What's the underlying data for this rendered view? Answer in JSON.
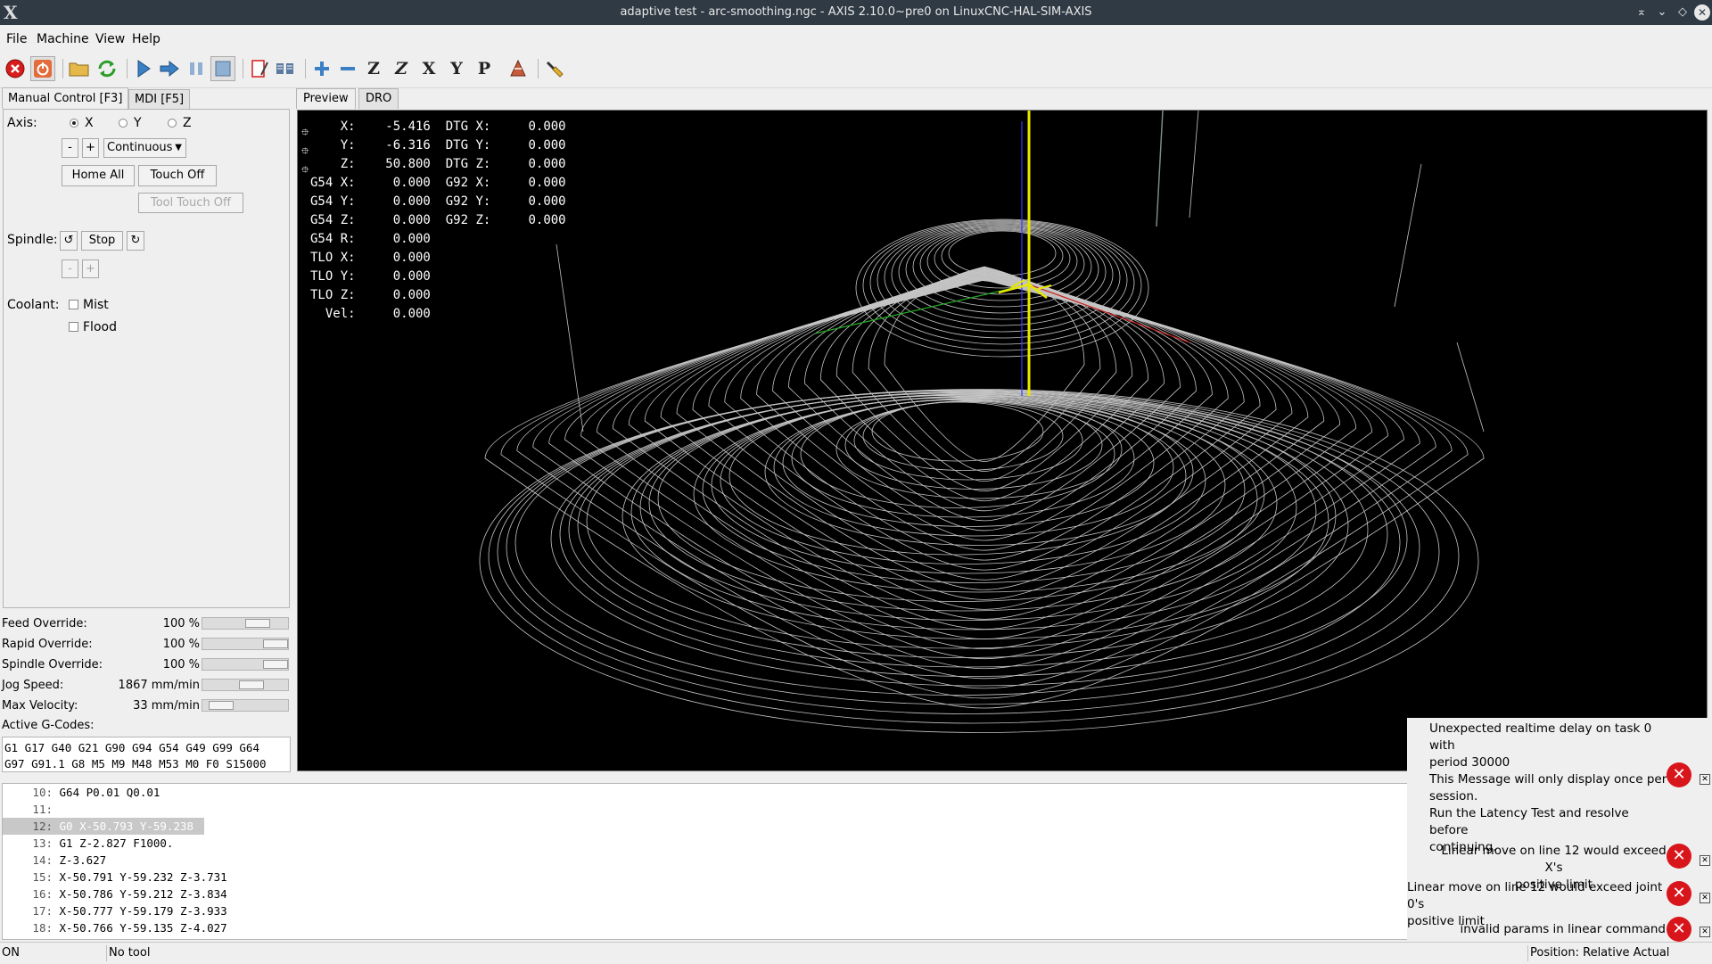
{
  "window": {
    "title": "adaptive test - arc-smoothing.ngc - AXIS 2.10.0~pre0 on LinuxCNC-HAL-SIM-AXIS"
  },
  "menu": {
    "file": "File",
    "machine": "Machine",
    "view": "View",
    "help": "Help"
  },
  "toolbar": {
    "icons": [
      "estop-icon",
      "power-icon",
      "open-file-icon",
      "reload-icon",
      "run-icon",
      "step-icon",
      "pause-icon",
      "stop-icon",
      "block-delete-icon",
      "optional-stop-icon",
      "zoom-in-icon",
      "zoom-out-icon",
      "view-z-icon",
      "view-z2-icon",
      "view-x-icon",
      "view-y-icon",
      "view-p-icon",
      "rotate-icon",
      "clear-plot-icon"
    ],
    "letters": {
      "z": "Z",
      "x": "X",
      "y": "Y",
      "p": "P"
    }
  },
  "tabs": {
    "manual": "Manual Control [F3]",
    "mdi": "MDI [F5]",
    "preview": "Preview",
    "dro": "DRO"
  },
  "manual": {
    "axis_label": "Axis:",
    "axes": [
      "X",
      "Y",
      "Z"
    ],
    "selected_axis": "X",
    "minus": "-",
    "plus": "+",
    "jog_mode": "Continuous",
    "home_all": "Home All",
    "touch_off": "Touch Off",
    "tool_touch_off": "Tool Touch Off",
    "spindle_label": "Spindle:",
    "spindle_stop": "Stop",
    "coolant_label": "Coolant:",
    "mist": "Mist",
    "flood": "Flood"
  },
  "overrides": [
    {
      "label": "Feed Override:",
      "value": "100 %",
      "level": 0.7
    },
    {
      "label": "Rapid Override:",
      "value": "100 %",
      "level": 1.0
    },
    {
      "label": "Spindle Override:",
      "value": "100 %",
      "level": 1.0
    },
    {
      "label": "Jog Speed:",
      "value": "1867 mm/min",
      "level": 0.6
    },
    {
      "label": "Max Velocity:",
      "value": "33 mm/min",
      "level": 0.1
    }
  ],
  "gcodes": {
    "label": "Active G-Codes:",
    "line1": "G1 G17 G40 G21 G90 G94 G54 G49 G99 G64",
    "line2": "G97 G91.1 G8 M5 M9 M48 M53 M0 F0 S15000"
  },
  "dro": [
    {
      "l1": "X:",
      "v1": "-5.416",
      "l2": "DTG X:",
      "v2": "0.000"
    },
    {
      "l1": "Y:",
      "v1": "-6.316",
      "l2": "DTG Y:",
      "v2": "0.000"
    },
    {
      "l1": "Z:",
      "v1": "50.800",
      "l2": "DTG Z:",
      "v2": "0.000"
    },
    {
      "l1": "G54 X:",
      "v1": "0.000",
      "l2": "G92 X:",
      "v2": "0.000"
    },
    {
      "l1": "G54 Y:",
      "v1": "0.000",
      "l2": "G92 Y:",
      "v2": "0.000"
    },
    {
      "l1": "G54 Z:",
      "v1": "0.000",
      "l2": "G92 Z:",
      "v2": "0.000"
    },
    {
      "l1": "G54 R:",
      "v1": "0.000",
      "l2": "",
      "v2": ""
    },
    {
      "l1": "TLO X:",
      "v1": "0.000",
      "l2": "",
      "v2": ""
    },
    {
      "l1": "TLO Y:",
      "v1": "0.000",
      "l2": "",
      "v2": ""
    },
    {
      "l1": "TLO Z:",
      "v1": "0.000",
      "l2": "",
      "v2": ""
    },
    {
      "l1": "Vel:",
      "v1": "0.000",
      "l2": "",
      "v2": ""
    }
  ],
  "code": [
    {
      "n": "10:",
      "t": "G64 P0.01 Q0.01"
    },
    {
      "n": "11:",
      "t": ""
    },
    {
      "n": "12:",
      "t": "G0 X-50.793 Y-59.238"
    },
    {
      "n": "13:",
      "t": "G1 Z-2.827 F1000."
    },
    {
      "n": "14:",
      "t": "Z-3.627"
    },
    {
      "n": "15:",
      "t": "X-50.791 Y-59.232 Z-3.731"
    },
    {
      "n": "16:",
      "t": "X-50.786 Y-59.212 Z-3.834"
    },
    {
      "n": "17:",
      "t": "X-50.777 Y-59.179 Z-3.933"
    },
    {
      "n": "18:",
      "t": "X-50.766 Y-59.135 Z-4.027"
    }
  ],
  "notifications": {
    "n1": [
      "Unexpected realtime delay on task 0 with",
      "period 30000",
      "This Message will only display once per",
      "session.",
      "Run the Latency Test and resolve before",
      "continuing."
    ],
    "n2": [
      "Linear move on line 12 would exceed X's",
      "positive limit"
    ],
    "n3": [
      "Linear move on line 12 would exceed joint 0's",
      "positive limit"
    ],
    "n4": [
      "invalid params in linear command"
    ]
  },
  "status": {
    "machine": "ON",
    "tool": "No tool",
    "position": "Position: Relative Actual"
  }
}
